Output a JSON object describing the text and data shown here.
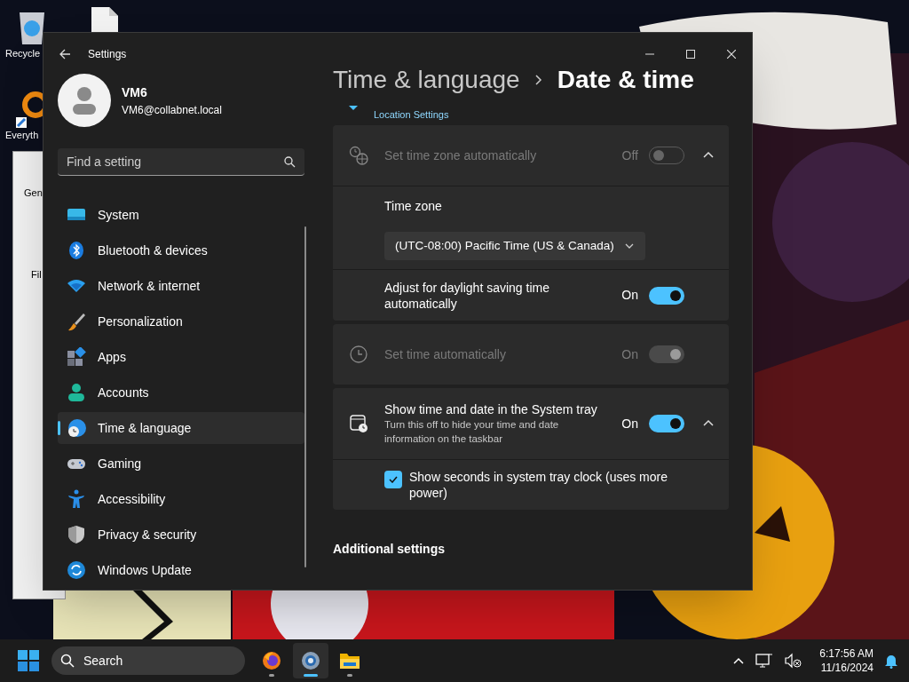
{
  "desktop": {
    "icons": [
      {
        "kind": "recycle",
        "label": "Recycle"
      },
      {
        "kind": "file"
      },
      {
        "kind": "search",
        "label": "Everyth"
      }
    ],
    "back_window": {
      "tab": "Gen",
      "label": "Fil"
    }
  },
  "settings": {
    "title": "Settings",
    "user": {
      "name": "VM6",
      "email": "VM6@collabnet.local"
    },
    "search": {
      "placeholder": "Find a setting"
    },
    "nav": [
      {
        "kind": "system",
        "label": "System",
        "selected": false
      },
      {
        "kind": "bluetooth",
        "label": "Bluetooth & devices",
        "selected": false
      },
      {
        "kind": "network",
        "label": "Network & internet",
        "selected": false
      },
      {
        "kind": "brush",
        "label": "Personalization",
        "selected": false
      },
      {
        "kind": "apps",
        "label": "Apps",
        "selected": false
      },
      {
        "kind": "accounts",
        "label": "Accounts",
        "selected": false
      },
      {
        "kind": "time",
        "label": "Time & language",
        "selected": true
      },
      {
        "kind": "gaming",
        "label": "Gaming",
        "selected": false
      },
      {
        "kind": "accessibility",
        "label": "Accessibility",
        "selected": false
      },
      {
        "kind": "privacy",
        "label": "Privacy & security",
        "selected": false
      },
      {
        "kind": "update",
        "label": "Windows Update",
        "selected": false
      }
    ],
    "breadcrumb": {
      "parent": "Time & language",
      "current": "Date & time"
    },
    "location_link": "Location Settings",
    "cards": [
      {
        "title": "Set time zone automatically",
        "disabled": true,
        "state_label": "Off",
        "on": false,
        "expanded": true,
        "children": [
          {
            "kind": "dropdown",
            "title": "Time zone",
            "value": "(UTC-08:00) Pacific Time (US & Canada)"
          },
          {
            "kind": "toggle",
            "title": "Adjust for daylight saving time automatically",
            "state_label": "On",
            "on": true,
            "disabled": false
          }
        ]
      },
      {
        "title": "Set time automatically",
        "disabled": true,
        "state_label": "On",
        "on": true
      },
      {
        "title": "Show time and date in the System tray",
        "description": "Turn this off to hide your time and date information on the taskbar",
        "disabled": false,
        "state_label": "On",
        "on": true,
        "expanded": true,
        "children": [
          {
            "kind": "checkbox",
            "label": "Show seconds in system tray clock (uses more power)",
            "checked": true
          }
        ]
      }
    ],
    "section_heading": "Additional settings"
  },
  "taskbar": {
    "search": {
      "placeholder": "Search"
    },
    "apps": [
      {
        "kind": "firefox",
        "selected": false
      },
      {
        "kind": "settings",
        "selected": true
      },
      {
        "kind": "folder",
        "selected": false
      }
    ],
    "time": "6:17:56 AM",
    "date": "11/16/2024"
  }
}
